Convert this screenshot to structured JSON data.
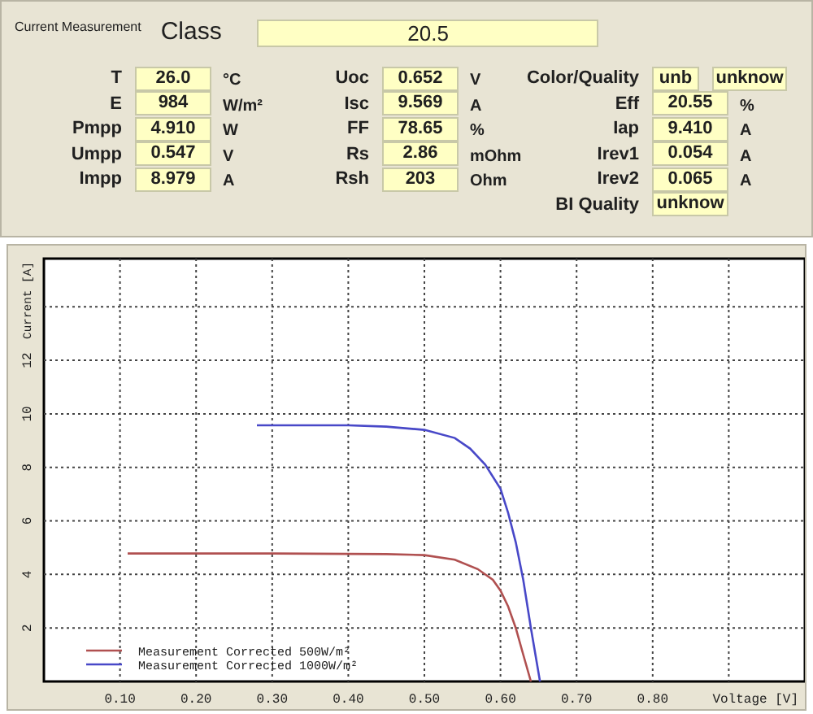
{
  "panel": {
    "title": "Current Measurement",
    "class_label": "Class",
    "class_value": "20.5",
    "columns": [
      [
        {
          "label": "T",
          "values": [
            "26.0"
          ],
          "unit": "°C"
        },
        {
          "label": "E",
          "values": [
            "984"
          ],
          "unit": "W/m²"
        },
        {
          "label": "Pmpp",
          "values": [
            "4.910"
          ],
          "unit": "W"
        },
        {
          "label": "Umpp",
          "values": [
            "0.547"
          ],
          "unit": "V"
        },
        {
          "label": "Impp",
          "values": [
            "8.979"
          ],
          "unit": "A"
        }
      ],
      [
        {
          "label": "Uoc",
          "values": [
            "0.652"
          ],
          "unit": "V"
        },
        {
          "label": "Isc",
          "values": [
            "9.569"
          ],
          "unit": "A"
        },
        {
          "label": "FF",
          "values": [
            "78.65"
          ],
          "unit": "%"
        },
        {
          "label": "Rs",
          "values": [
            "2.86"
          ],
          "unit": "mOhm"
        },
        {
          "label": "Rsh",
          "values": [
            "203"
          ],
          "unit": "Ohm"
        }
      ],
      [
        {
          "label": "Color/Quality",
          "values": [
            "unb",
            "unknow"
          ]
        },
        {
          "label": "Eff",
          "values": [
            "20.55"
          ],
          "unit": "%"
        },
        {
          "label": "Iap",
          "values": [
            "9.410"
          ],
          "unit": "A"
        },
        {
          "label": "Irev1",
          "values": [
            "0.054"
          ],
          "unit": "A"
        },
        {
          "label": "Irev2",
          "values": [
            "0.065"
          ],
          "unit": "A"
        },
        {
          "label": "BI Quality",
          "values": [
            "unknow"
          ]
        }
      ]
    ]
  },
  "chart": {
    "chart_data": {
      "type": "line",
      "xlabel": "Voltage [V]",
      "ylabel": "Current [A]",
      "xlim": [
        0,
        1
      ],
      "ylim": [
        0,
        15.8
      ],
      "grid": true,
      "legend": true,
      "xticks": [
        {
          "value": 0.1,
          "label": "0.10"
        },
        {
          "value": 0.2,
          "label": "0.20"
        },
        {
          "value": 0.3,
          "label": "0.30"
        },
        {
          "value": 0.4,
          "label": "0.40"
        },
        {
          "value": 0.5,
          "label": "0.50"
        },
        {
          "value": 0.6,
          "label": "0.60"
        },
        {
          "value": 0.7,
          "label": "0.70"
        },
        {
          "value": 0.8,
          "label": "0.80"
        }
      ],
      "yticks": [
        2,
        4,
        6,
        8,
        10,
        12
      ],
      "series": [
        {
          "name": "Measurement Corrected 500W/m²",
          "color": "#b05050",
          "x": [
            0.11,
            0.3,
            0.45,
            0.5,
            0.54,
            0.57,
            0.59,
            0.6,
            0.61,
            0.62,
            0.63,
            0.64
          ],
          "values": [
            4.78,
            4.78,
            4.76,
            4.72,
            4.55,
            4.2,
            3.8,
            3.4,
            2.8,
            2.0,
            1.0,
            0
          ]
        },
        {
          "name": "Measurement Corrected 1000W/m²",
          "color": "#4848c8",
          "x": [
            0.28,
            0.4,
            0.45,
            0.5,
            0.54,
            0.56,
            0.58,
            0.6,
            0.61,
            0.62,
            0.63,
            0.64,
            0.652
          ],
          "values": [
            9.57,
            9.57,
            9.52,
            9.4,
            9.1,
            8.7,
            8.1,
            7.2,
            6.3,
            5.2,
            3.8,
            2.0,
            0
          ]
        }
      ]
    }
  }
}
